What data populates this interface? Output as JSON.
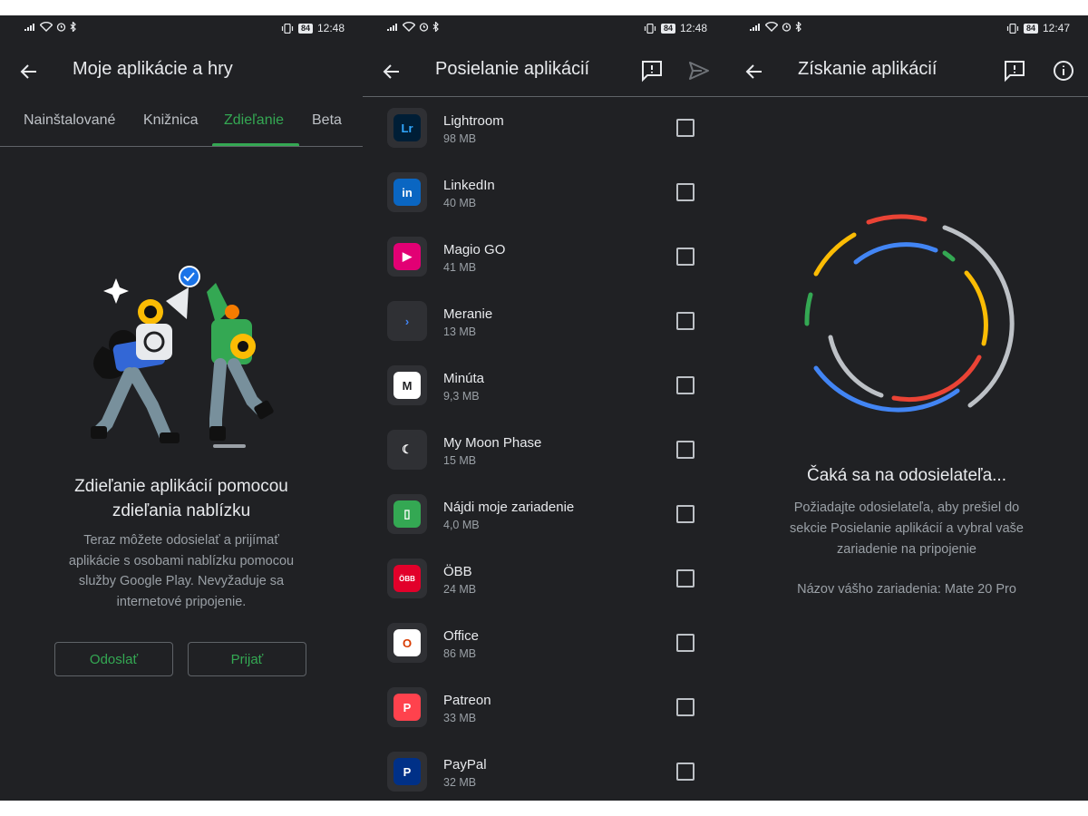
{
  "panel1": {
    "status": {
      "time": "12:48",
      "battery": "84"
    },
    "title": "Moje aplikácie a hry",
    "tabs": [
      "Nainštalované",
      "Knižnica",
      "Zdieľanie",
      "Beta"
    ],
    "active_tab": "Zdieľanie",
    "headline_line1": "Zdieľanie aplikácií pomocou",
    "headline_line2": "zdieľania nablízku",
    "body_lines": [
      "Teraz môžete odosielať a prijímať",
      "aplikácie s osobami nablízku pomocou",
      "služby Google Play. Nevyžaduje sa",
      "internetové pripojenie."
    ],
    "send_label": "Odoslať",
    "receive_label": "Prijať"
  },
  "panel2": {
    "status": {
      "time": "12:48",
      "battery": "84"
    },
    "title": "Posielanie aplikácií",
    "apps": [
      {
        "name": "Lightroom",
        "size": "98 MB",
        "icon": "lightroom-icon",
        "color": "#001e36",
        "glyph": "Lr",
        "glyph_color": "#31a8ff"
      },
      {
        "name": "LinkedIn",
        "size": "40 MB",
        "icon": "linkedin-icon",
        "color": "#0a66c2",
        "glyph": "in",
        "glyph_color": "#ffffff"
      },
      {
        "name": "Magio GO",
        "size": "41 MB",
        "icon": "magio-go-icon",
        "color": "#e20074",
        "glyph": "▶",
        "glyph_color": "#ffffff"
      },
      {
        "name": "Meranie",
        "size": "13 MB",
        "icon": "meranie-icon",
        "color": "#2f3034",
        "glyph": "›",
        "glyph_color": "#4285f4"
      },
      {
        "name": "Minúta",
        "size": "9,3 MB",
        "icon": "minuta-icon",
        "color": "#ffffff",
        "glyph": "M",
        "glyph_color": "#202124"
      },
      {
        "name": "My Moon Phase",
        "size": "15 MB",
        "icon": "moon-phase-icon",
        "color": "#2f3034",
        "glyph": "☾",
        "glyph_color": "#ffffff"
      },
      {
        "name": "Nájdi moje zariadenie",
        "size": "4,0 MB",
        "icon": "find-my-device-icon",
        "color": "#34a853",
        "glyph": "▯",
        "glyph_color": "#ffffff"
      },
      {
        "name": "ÖBB",
        "size": "24 MB",
        "icon": "obb-icon",
        "color": "#e2002a",
        "glyph": "ÖBB",
        "glyph_color": "#ffffff"
      },
      {
        "name": "Office",
        "size": "86 MB",
        "icon": "office-icon",
        "color": "#ffffff",
        "glyph": "O",
        "glyph_color": "#d83b01"
      },
      {
        "name": "Patreon",
        "size": "33 MB",
        "icon": "patreon-icon",
        "color": "#ff424d",
        "glyph": "P",
        "glyph_color": "#ffffff"
      },
      {
        "name": "PayPal",
        "size": "32 MB",
        "icon": "paypal-icon",
        "color": "#003087",
        "glyph": "P",
        "glyph_color": "#ffffff"
      }
    ]
  },
  "panel3": {
    "status": {
      "time": "12:47",
      "battery": "84"
    },
    "title": "Získanie aplikácií",
    "wait_title": "Čaká sa na odosielateľa...",
    "wait_lines": [
      "Požiadajte odosielateľa, aby prešiel do",
      "sekcie Posielanie aplikácií a vybral vaše",
      "zariadenie na pripojenie"
    ],
    "device_name": "Názov vášho zariadenia: Mate 20 Pro"
  },
  "colors": {
    "accent": "#34a853",
    "background": "#202124",
    "text": "#e8eaed",
    "secondary_text": "#9aa0a6"
  }
}
